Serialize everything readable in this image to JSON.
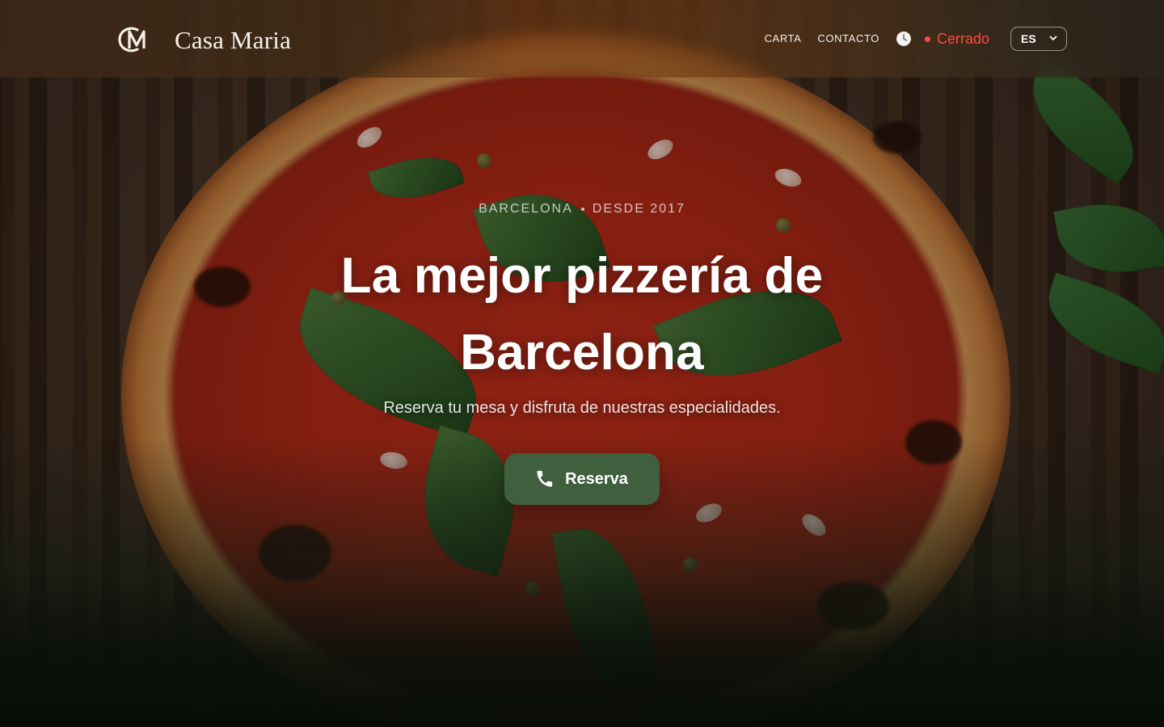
{
  "brand": {
    "monogram": "CM",
    "name": "Casa Maria"
  },
  "nav": {
    "menu_label": "CARTA",
    "contact_label": "CONTACTO",
    "status_label": "Cerrado",
    "language_value": "ES"
  },
  "hero": {
    "kicker_city": "BARCELONA",
    "kicker_since": "DESDE 2017",
    "title_line1": "La mejor pizzería de",
    "title_line2": "Barcelona",
    "subtitle": "Reserva tu mesa y disfruta de nuestras especialidades.",
    "cta_label": "Reserva"
  },
  "icons": {
    "status": "clock-icon",
    "call": "phone-icon",
    "dropdown": "chevron-down-icon"
  },
  "colors": {
    "status_closed": "#ff4a3d",
    "cta_bg": "#3f5f3f",
    "text_light": "#f6f1ea"
  }
}
